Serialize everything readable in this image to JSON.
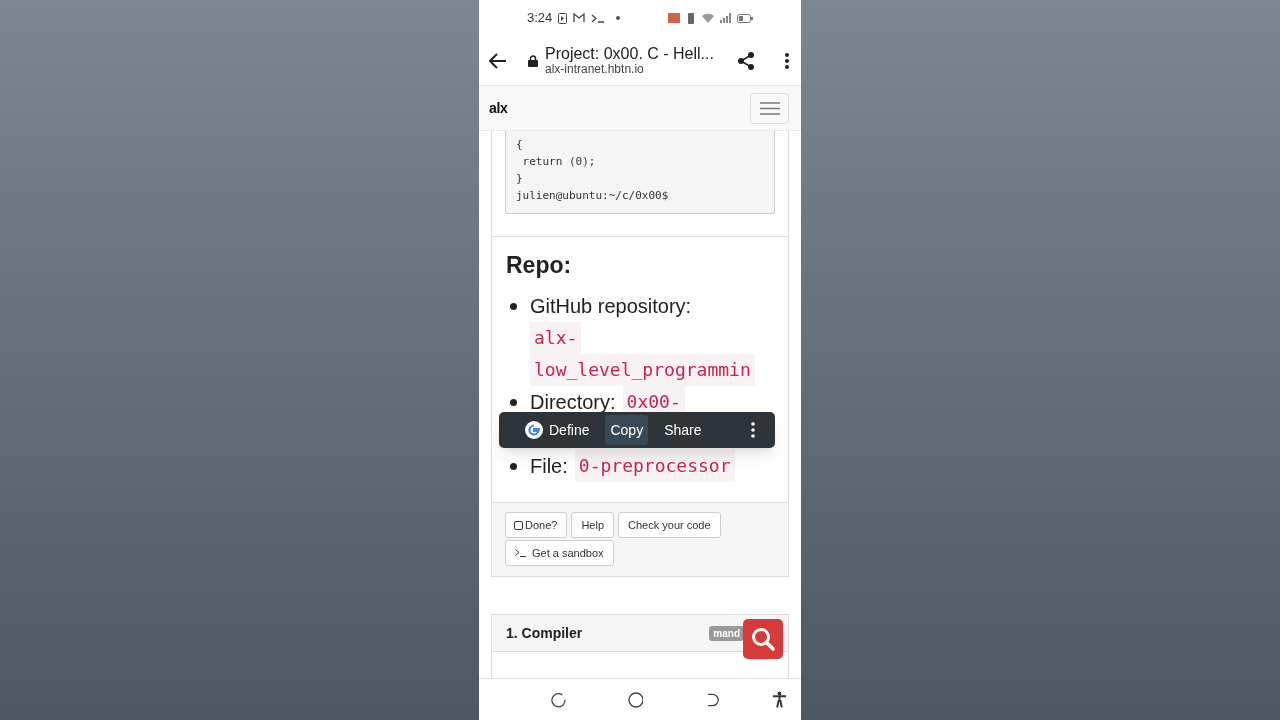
{
  "status_bar": {
    "time": "3:24"
  },
  "browser": {
    "title": "Project: 0x00. C - Hell...",
    "url": "alx-intranet.hbtn.io"
  },
  "site_header": {
    "logo": "alx"
  },
  "code_block": {
    "lines": [
      "{",
      " return (0);",
      "}",
      "julien@ubuntu:~/c/0x00$"
    ]
  },
  "repo": {
    "heading": "Repo:",
    "items": [
      {
        "label": "GitHub repository:",
        "code": [
          "alx-",
          "low_level_programmin"
        ]
      },
      {
        "label": "Directory:",
        "code": [
          "0x00-"
        ]
      },
      {
        "label": "File:",
        "code": [
          "0-preprocessor"
        ]
      }
    ]
  },
  "selection_menu": {
    "items": [
      {
        "label": "Define",
        "kind": "google"
      },
      {
        "label": "Copy",
        "kind": "plain",
        "selected": true
      },
      {
        "label": "Share",
        "kind": "plain",
        "selected": false
      }
    ]
  },
  "task_buttons": [
    {
      "label": "Done?",
      "kind": "checkbox",
      "checked": false
    },
    {
      "label": "Help",
      "kind": "plain"
    },
    {
      "label": "Check your code",
      "kind": "plain"
    },
    {
      "label": "Get a sandbox",
      "kind": "terminal"
    }
  ],
  "next_task": {
    "title": "1. Compiler",
    "badge": "mand"
  }
}
